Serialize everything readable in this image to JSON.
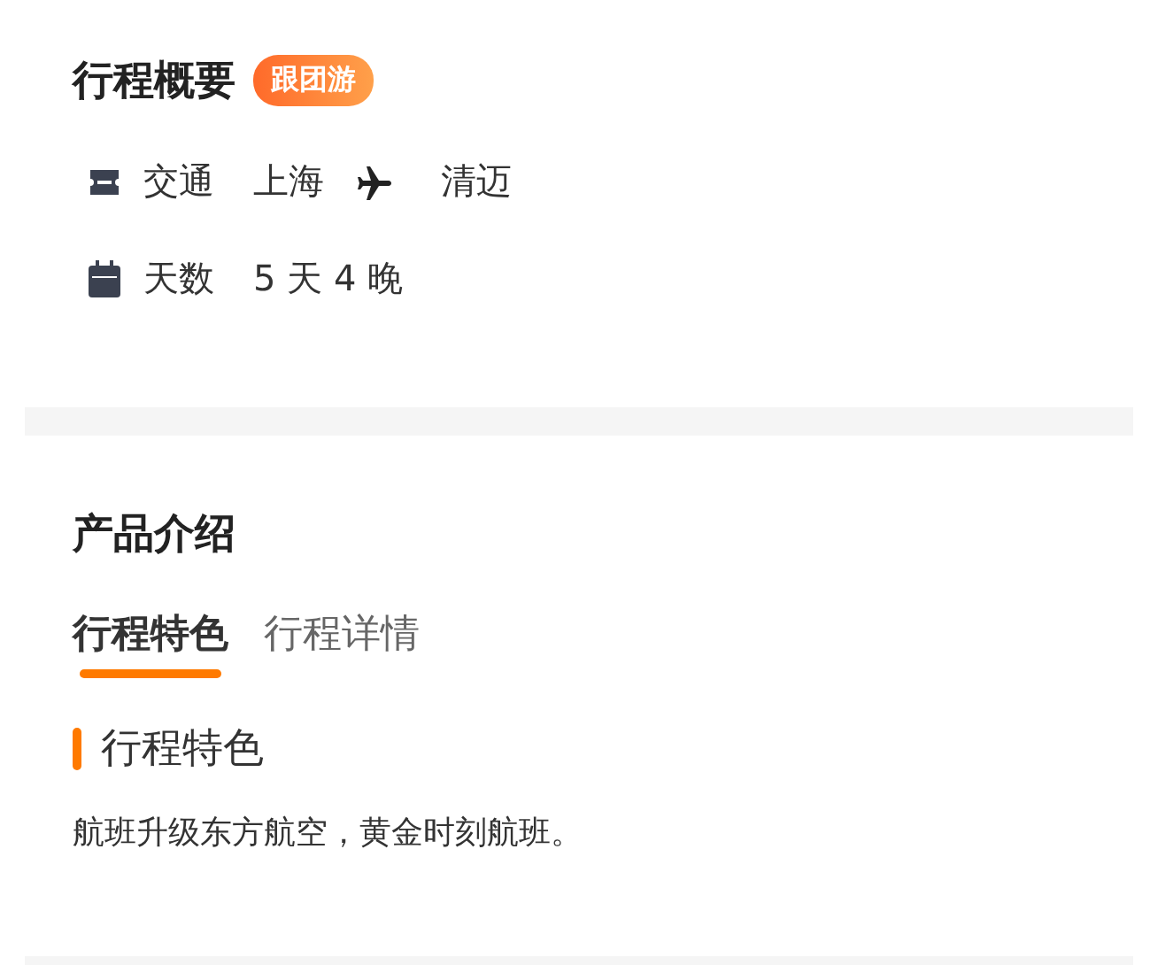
{
  "overview": {
    "title": "行程概要",
    "badge": "跟团游",
    "rows": [
      {
        "kind": "transport",
        "label": "交通",
        "from": "上海",
        "to": "清迈"
      },
      {
        "kind": "days",
        "label": "天数",
        "value": "5 天 4 晚"
      }
    ]
  },
  "product": {
    "title": "产品介绍",
    "tabs": [
      {
        "label": "行程特色",
        "selected": true
      },
      {
        "label": "行程详情",
        "selected": false
      }
    ],
    "section_title": "行程特色",
    "text": "航班升级东方航空，黄金时刻航班。"
  }
}
